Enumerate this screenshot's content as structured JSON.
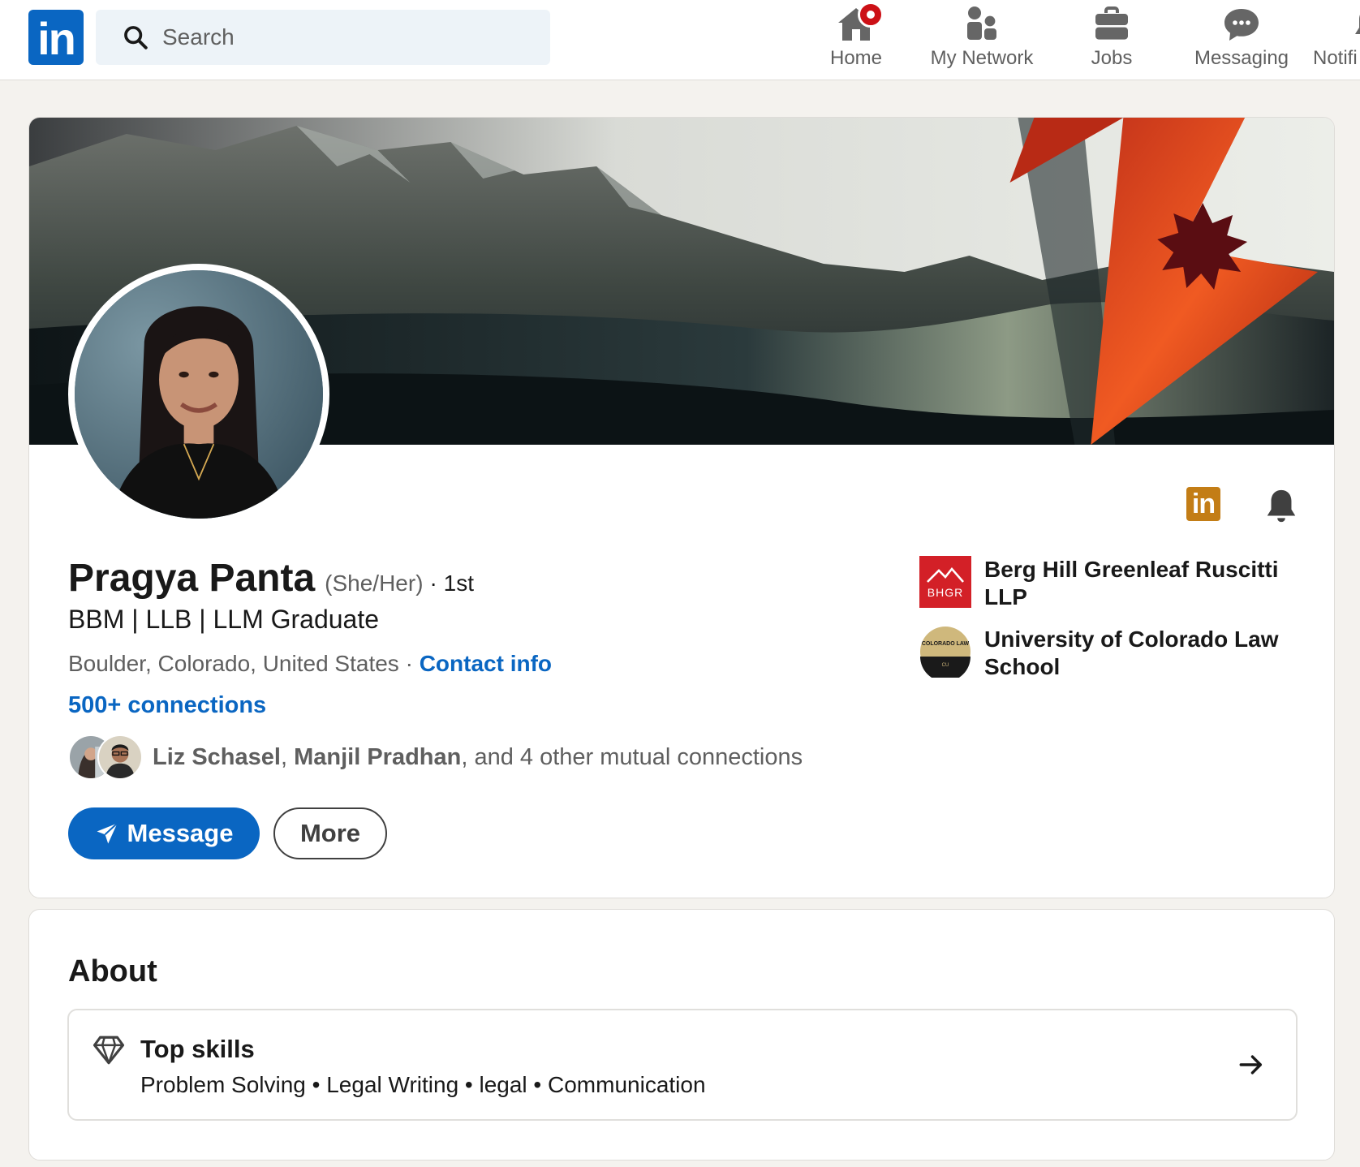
{
  "nav": {
    "logo_text": "in",
    "search_placeholder": "Search",
    "items": [
      {
        "label": "Home",
        "icon": "home-icon",
        "badge": true
      },
      {
        "label": "My Network",
        "icon": "network-icon"
      },
      {
        "label": "Jobs",
        "icon": "briefcase-icon"
      },
      {
        "label": "Messaging",
        "icon": "messaging-icon"
      },
      {
        "label": "Notifi",
        "icon": "notifications-icon"
      }
    ]
  },
  "profile": {
    "name": "Pragya Panta",
    "pronouns": "(She/Her)",
    "degree": "· 1st",
    "headline": "BBM | LLB | LLM Graduate",
    "location": "Boulder, Colorado, United States",
    "location_sep": " · ",
    "contact_info": "Contact info",
    "connections": "500+ connections",
    "mutual": {
      "name1": "Liz Schasel",
      "sep": ", ",
      "name2": "Manjil Pradhan",
      "rest": ", and 4 other mutual connections"
    },
    "message_button": "Message",
    "more_button": "More",
    "premium_badge": "in",
    "orgs": [
      {
        "name": "Berg Hill Greenleaf Ruscitti LLP",
        "logo": "BHGR",
        "icon": "bhgr-logo-icon"
      },
      {
        "name": "University of Colorado Law School",
        "logo": "COLORADO LAW",
        "icon": "colorado-law-logo-icon"
      }
    ]
  },
  "about": {
    "title": "About",
    "top_skills_title": "Top skills",
    "top_skills": "Problem Solving • Legal Writing • legal • Communication"
  },
  "colors": {
    "brand": "#0a66c2",
    "notification": "#cc1016",
    "premium": "#c37d16",
    "page_bg": "#f4f2ee"
  }
}
